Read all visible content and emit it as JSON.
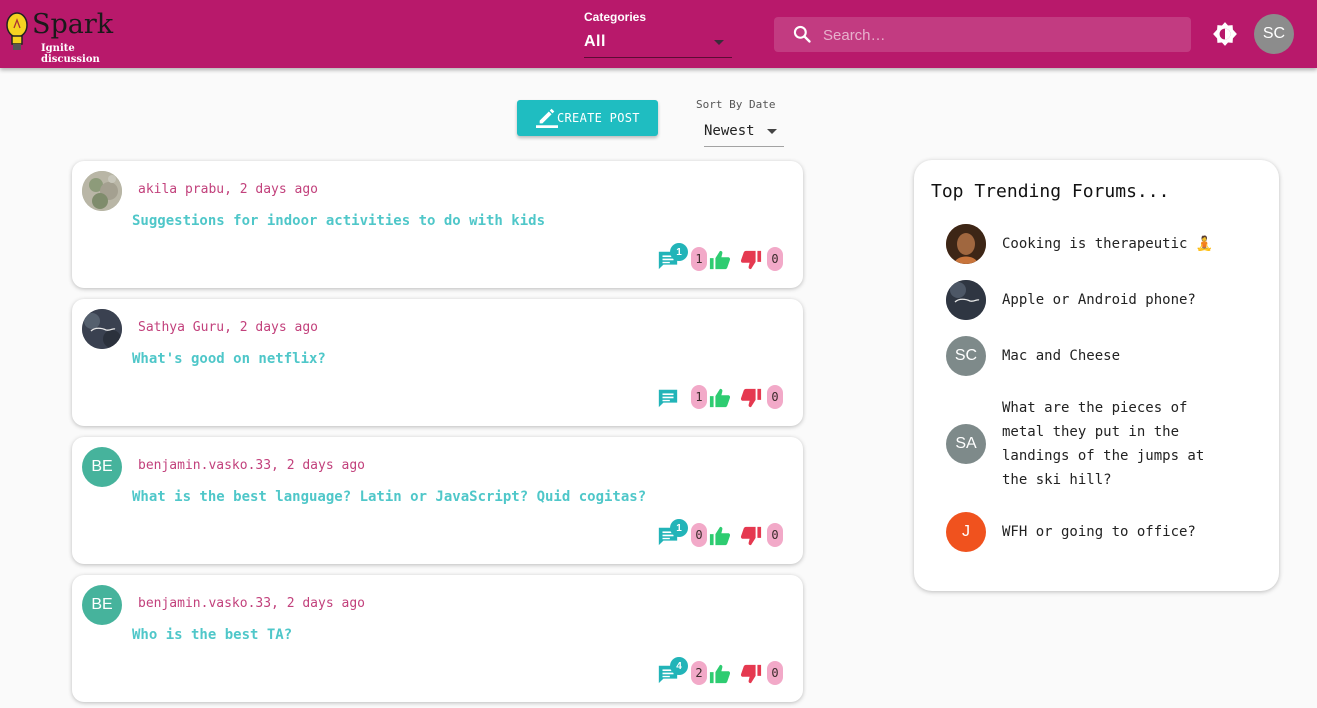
{
  "header": {
    "logo_title": "Spark",
    "logo_subtitle": "Ignite discussion",
    "category_label": "Categories",
    "category_value": "All",
    "search_placeholder": "Search…",
    "user_initials": "SC"
  },
  "toolbar": {
    "create_post_label": "CREATE POST",
    "sort_label": "Sort By Date",
    "sort_value": "Newest"
  },
  "posts": [
    {
      "author": "akila prabu, 2 days ago",
      "title": "Suggestions for indoor activities to do with kids",
      "avatar_initials": "",
      "comments": "1",
      "likes": "1",
      "dislikes": "0"
    },
    {
      "author": "Sathya Guru, 2 days ago",
      "title": "What's good on netflix?",
      "avatar_initials": "",
      "comments": "",
      "likes": "1",
      "dislikes": "0"
    },
    {
      "author": "benjamin.vasko.33, 2 days ago",
      "title": "What is the best language? Latin or JavaScript? Quid cogitas?",
      "avatar_initials": "BE",
      "comments": "1",
      "likes": "0",
      "dislikes": "0"
    },
    {
      "author": "benjamin.vasko.33, 2 days ago",
      "title": "Who is the best TA?",
      "avatar_initials": "BE",
      "comments": "4",
      "likes": "2",
      "dislikes": "0"
    }
  ],
  "trending": {
    "title": "Top Trending Forums...",
    "items": [
      {
        "text": "Cooking is therapeutic 🧘",
        "avatar_initials": ""
      },
      {
        "text": "Apple or Android phone?",
        "avatar_initials": ""
      },
      {
        "text": "Mac and Cheese",
        "avatar_initials": "SC"
      },
      {
        "text": "What are the pieces of metal they put in the landings of the jumps at the ski hill?",
        "avatar_initials": "SA"
      },
      {
        "text": "WFH or going to office?",
        "avatar_initials": "J"
      }
    ]
  },
  "colors": {
    "header_bg": "#b8196b",
    "accent_teal": "#1fbdc1",
    "like_green": "#2ecc71",
    "dislike_red": "#e53950",
    "count_pill": "#f2a9c8"
  }
}
